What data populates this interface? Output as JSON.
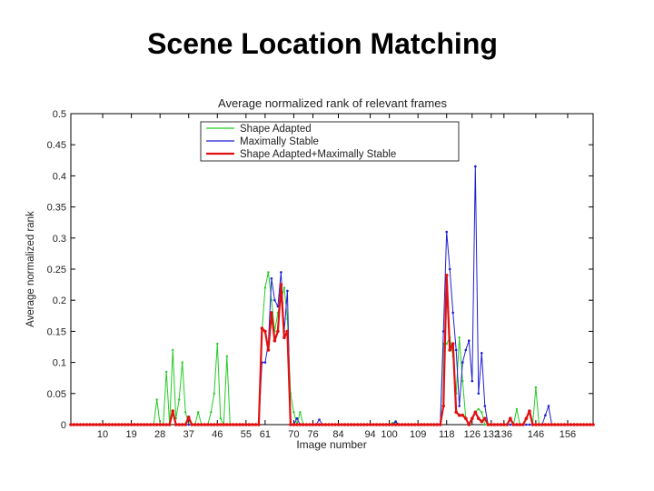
{
  "slide": {
    "title": "Scene Location Matching"
  },
  "chart_data": {
    "type": "line",
    "title": "Average normalized rank of relevant frames",
    "xlabel": "Image number",
    "ylabel": "Average normalized rank",
    "xlim": [
      0,
      164
    ],
    "ylim": [
      0,
      0.5
    ],
    "xticks": [
      10,
      19,
      28,
      37,
      46,
      55,
      61,
      70,
      76,
      84,
      94,
      100,
      109,
      118,
      126,
      132,
      136,
      146,
      156
    ],
    "yticks": [
      0,
      0.05,
      0.1,
      0.15,
      0.2,
      0.25,
      0.3,
      0.35,
      0.4,
      0.45,
      0.5
    ],
    "ytick_labels": [
      "0",
      "0.05",
      "0.1",
      "0.15",
      "0.2",
      "0.25",
      "0.3",
      "0.35",
      "0.4",
      "0.45",
      "0.5"
    ],
    "grid": false,
    "legend_position": "top-left",
    "colors": {
      "green": "#22cc22",
      "blue": "#1f1fd0",
      "red": "#e01010"
    },
    "series": [
      {
        "name": "Shape Adapted",
        "color": "#22cc22",
        "points": [
          [
            0,
            0
          ],
          [
            26,
            0
          ],
          [
            27,
            0.04
          ],
          [
            28,
            0
          ],
          [
            29,
            0
          ],
          [
            30,
            0.085
          ],
          [
            31,
            0
          ],
          [
            32,
            0.12
          ],
          [
            33,
            0.01
          ],
          [
            34,
            0.04
          ],
          [
            35,
            0.1
          ],
          [
            36,
            0.02
          ],
          [
            37,
            0
          ],
          [
            39,
            0
          ],
          [
            40,
            0.02
          ],
          [
            41,
            0
          ],
          [
            43,
            0
          ],
          [
            44,
            0.02
          ],
          [
            45,
            0.05
          ],
          [
            46,
            0.13
          ],
          [
            47,
            0.01
          ],
          [
            48,
            0
          ],
          [
            49,
            0.11
          ],
          [
            50,
            0
          ],
          [
            59,
            0
          ],
          [
            60,
            0.15
          ],
          [
            61,
            0.22
          ],
          [
            62,
            0.245
          ],
          [
            63,
            0.2
          ],
          [
            64,
            0.15
          ],
          [
            65,
            0.18
          ],
          [
            66,
            0.2
          ],
          [
            67,
            0.22
          ],
          [
            68,
            0.17
          ],
          [
            69,
            0.05
          ],
          [
            70,
            0.02
          ],
          [
            71,
            0
          ],
          [
            72,
            0.02
          ],
          [
            73,
            0
          ],
          [
            100,
            0
          ],
          [
            102,
            0.005
          ],
          [
            103,
            0
          ],
          [
            116,
            0
          ],
          [
            117,
            0.13
          ],
          [
            118,
            0.13
          ],
          [
            119,
            0.14
          ],
          [
            120,
            0.11
          ],
          [
            121,
            0.05
          ],
          [
            122,
            0.14
          ],
          [
            123,
            0.07
          ],
          [
            124,
            0.01
          ],
          [
            125,
            0
          ],
          [
            127,
            0.02
          ],
          [
            128,
            0.025
          ],
          [
            129,
            0.02
          ],
          [
            130,
            0
          ],
          [
            139,
            0
          ],
          [
            140,
            0.025
          ],
          [
            141,
            0
          ],
          [
            145,
            0
          ],
          [
            146,
            0.06
          ],
          [
            147,
            0
          ],
          [
            164,
            0
          ]
        ]
      },
      {
        "name": "Maximally Stable",
        "color": "#1f1fd0",
        "points": [
          [
            0,
            0
          ],
          [
            31,
            0
          ],
          [
            32,
            0.02
          ],
          [
            33,
            0
          ],
          [
            59,
            0
          ],
          [
            60,
            0.1
          ],
          [
            61,
            0.1
          ],
          [
            62,
            0.13
          ],
          [
            63,
            0.235
          ],
          [
            64,
            0.2
          ],
          [
            65,
            0.19
          ],
          [
            66,
            0.245
          ],
          [
            67,
            0.15
          ],
          [
            68,
            0.215
          ],
          [
            69,
            0
          ],
          [
            70,
            0
          ],
          [
            71,
            0.01
          ],
          [
            72,
            0
          ],
          [
            77,
            0
          ],
          [
            78,
            0.008
          ],
          [
            79,
            0
          ],
          [
            101,
            0
          ],
          [
            102,
            0.005
          ],
          [
            103,
            0
          ],
          [
            116,
            0
          ],
          [
            117,
            0.15
          ],
          [
            118,
            0.31
          ],
          [
            119,
            0.25
          ],
          [
            120,
            0.18
          ],
          [
            121,
            0.12
          ],
          [
            122,
            0.03
          ],
          [
            123,
            0.1
          ],
          [
            124,
            0.12
          ],
          [
            125,
            0.135
          ],
          [
            126,
            0.07
          ],
          [
            127,
            0.415
          ],
          [
            128,
            0.05
          ],
          [
            129,
            0.115
          ],
          [
            130,
            0.03
          ],
          [
            131,
            0
          ],
          [
            148,
            0
          ],
          [
            149,
            0.015
          ],
          [
            150,
            0.03
          ],
          [
            151,
            0
          ],
          [
            164,
            0
          ]
        ]
      },
      {
        "name": "Shape Adapted+Maximally Stable",
        "color": "#e01010",
        "points": [
          [
            0,
            0
          ],
          [
            31,
            0
          ],
          [
            32,
            0.022
          ],
          [
            33,
            0
          ],
          [
            36,
            0
          ],
          [
            37,
            0.012
          ],
          [
            38,
            0
          ],
          [
            59,
            0
          ],
          [
            60,
            0.155
          ],
          [
            61,
            0.15
          ],
          [
            62,
            0.12
          ],
          [
            63,
            0.18
          ],
          [
            64,
            0.135
          ],
          [
            65,
            0.15
          ],
          [
            66,
            0.225
          ],
          [
            67,
            0.14
          ],
          [
            68,
            0.15
          ],
          [
            69,
            0
          ],
          [
            116,
            0
          ],
          [
            117,
            0.03
          ],
          [
            118,
            0.24
          ],
          [
            119,
            0.12
          ],
          [
            120,
            0.13
          ],
          [
            121,
            0.02
          ],
          [
            122,
            0.015
          ],
          [
            123,
            0.015
          ],
          [
            124,
            0.01
          ],
          [
            125,
            0
          ],
          [
            127,
            0.02
          ],
          [
            128,
            0.01
          ],
          [
            129,
            0.005
          ],
          [
            130,
            0.01
          ],
          [
            131,
            0
          ],
          [
            137,
            0
          ],
          [
            138,
            0.01
          ],
          [
            139,
            0
          ],
          [
            142,
            0
          ],
          [
            143,
            0.01
          ],
          [
            144,
            0.022
          ],
          [
            145,
            0
          ],
          [
            164,
            0
          ]
        ]
      }
    ]
  }
}
